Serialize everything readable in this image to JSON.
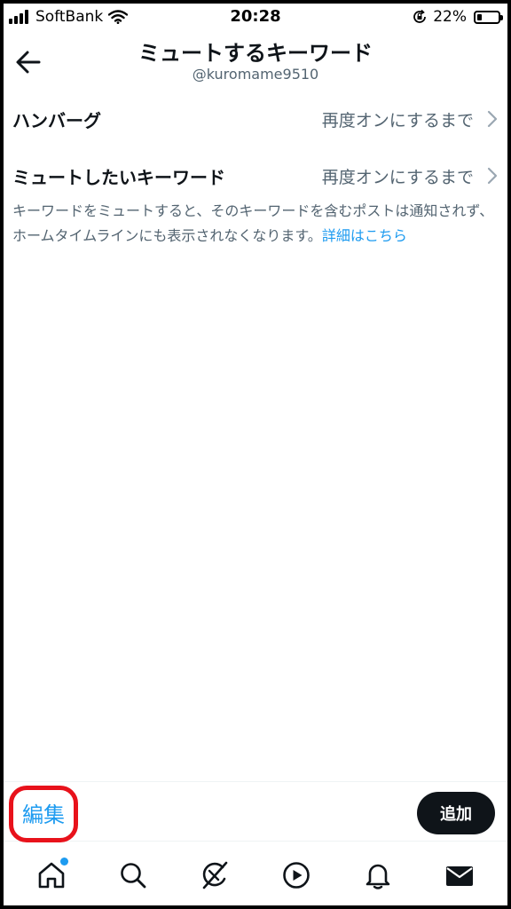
{
  "status_bar": {
    "carrier": "SoftBank",
    "time": "20:28",
    "battery_percent": "22%",
    "battery_level": 0.22
  },
  "header": {
    "title": "ミュートするキーワード",
    "account": "@kuromame9510"
  },
  "keywords": [
    {
      "label": "ハンバーグ",
      "duration": "再度オンにするまで"
    },
    {
      "label": "ミュートしたいキーワード",
      "duration": "再度オンにするまで"
    }
  ],
  "info": {
    "text": "キーワードをミュートすると、そのキーワードを含むポストは通知されず、ホームタイムラインにも表示されなくなります。",
    "link": "詳細はこちら"
  },
  "actions": {
    "edit_label": "編集",
    "add_label": "追加",
    "highlight_color": "#e8121b"
  },
  "tabs": [
    {
      "icon": "home-icon",
      "badge": true
    },
    {
      "icon": "search-icon"
    },
    {
      "icon": "grok-icon"
    },
    {
      "icon": "play-icon"
    },
    {
      "icon": "bell-icon"
    },
    {
      "icon": "mail-icon"
    }
  ],
  "colors": {
    "accent": "#1d9bf0",
    "text_primary": "#0f1419",
    "text_secondary": "#536471"
  }
}
